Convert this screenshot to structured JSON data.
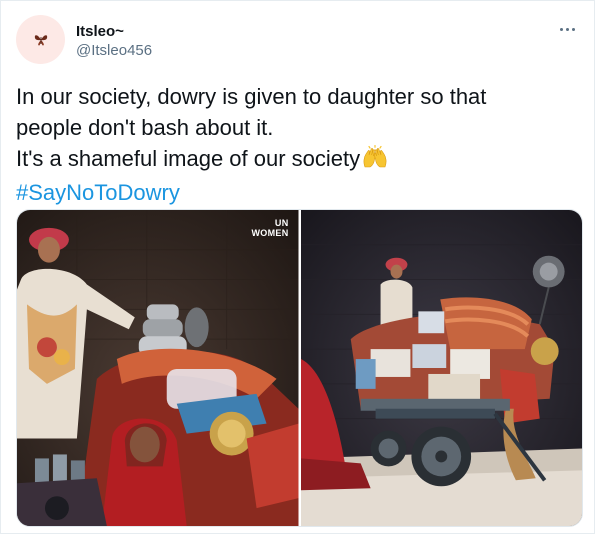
{
  "tweet": {
    "author": {
      "display_name": "Itsleo~",
      "handle": "@Itsleo456",
      "avatar_icon": "butterfly-icon"
    },
    "more_icon": "more-options-icon",
    "text": {
      "line1": "In our society, dowry is given to daughter so that",
      "line2": "people don't bash about it.",
      "line3": "It's a shameful image of our society",
      "emoji": "raising-hands-emoji",
      "hashtag": "#SayNoToDowry"
    },
    "media": {
      "watermark_line1": "UN",
      "watermark_line2": "WOMEN",
      "photos": [
        "bride-and-father-with-dowry-cart-closeup",
        "dowry-cart-wide-shot"
      ]
    },
    "colors": {
      "hashtag": "#1b95e0",
      "secondary_text": "#5b7083",
      "border": "#e6ecf0"
    }
  }
}
